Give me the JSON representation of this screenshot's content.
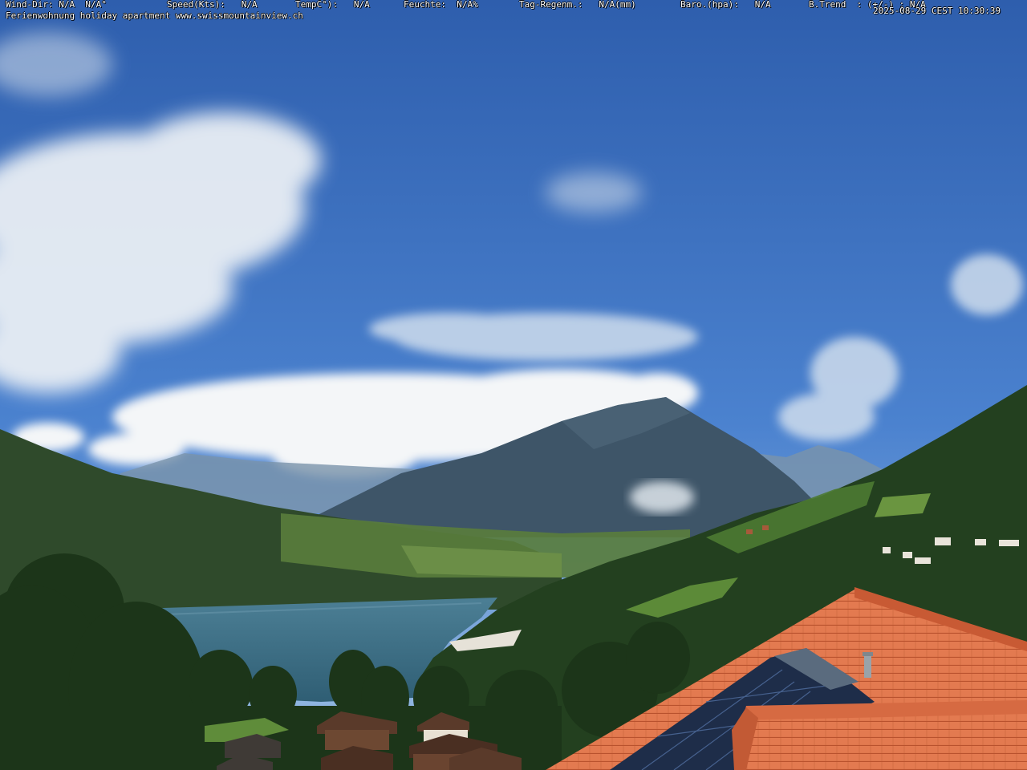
{
  "weather_bar": {
    "wind_dir": "Wind-Dir: N/A  N/A°",
    "speed": "Speed(Kts):   N/A",
    "temp": "TempC°):   N/A",
    "humidity": "Feuchte:  N/A%",
    "rain": "Tag-Regenm.:   N/A(mm)",
    "baro": "Baro.(hpa):   N/A",
    "btrend": "B.Trend  : (+/-) : N/A",
    "timestamp": "2025-08-29 CEST 10:30:39"
  },
  "caption": "Ferienwohnung holiday apartment www.swissmountainview.ch",
  "colors": {
    "sky_top": "#2f5fae",
    "sky_bottom": "#8fb4dd",
    "lake": "#3c6f86",
    "roof": "#e0714a",
    "forest": "#23401f",
    "meadow": "#6e9a3c"
  }
}
